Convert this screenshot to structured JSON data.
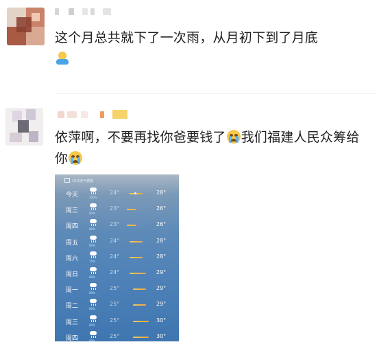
{
  "comments": [
    {
      "text": "这个月总共就下了一次雨，从月初下到了月底",
      "emoji": "waving-person-emoji"
    },
    {
      "text": "依萍啊，不要再找你爸要钱了",
      "text_after": "我们福建人民众筹给你",
      "emoji": "crying-face-emoji"
    }
  ],
  "forecast": {
    "header": "10日天气预报",
    "icon": "rain-cloud-icon",
    "days": [
      {
        "day": "今天",
        "chance": "100%",
        "low": "24°",
        "high": "28°"
      },
      {
        "day": "周三",
        "chance": "80%",
        "low": "23°",
        "high": "26°"
      },
      {
        "day": "周四",
        "chance": "80%",
        "low": "23°",
        "high": "26°"
      },
      {
        "day": "周五",
        "chance": "90%",
        "low": "24°",
        "high": "28°"
      },
      {
        "day": "周六",
        "chance": "70%",
        "low": "24°",
        "high": "28°"
      },
      {
        "day": "周日",
        "chance": "80%",
        "low": "24°",
        "high": "29°"
      },
      {
        "day": "周一",
        "chance": "80%",
        "low": "25°",
        "high": "29°"
      },
      {
        "day": "周二",
        "chance": "80%",
        "low": "25°",
        "high": "29°"
      },
      {
        "day": "周三",
        "chance": "80%",
        "low": "25°",
        "high": "30°"
      },
      {
        "day": "周四",
        "chance": "80%",
        "low": "25°",
        "high": "30°"
      }
    ]
  },
  "colors": {
    "bar_warm": "#f3a63e",
    "bar_light": "#f1cc5b",
    "rain_percent": "#bfe3ff"
  }
}
